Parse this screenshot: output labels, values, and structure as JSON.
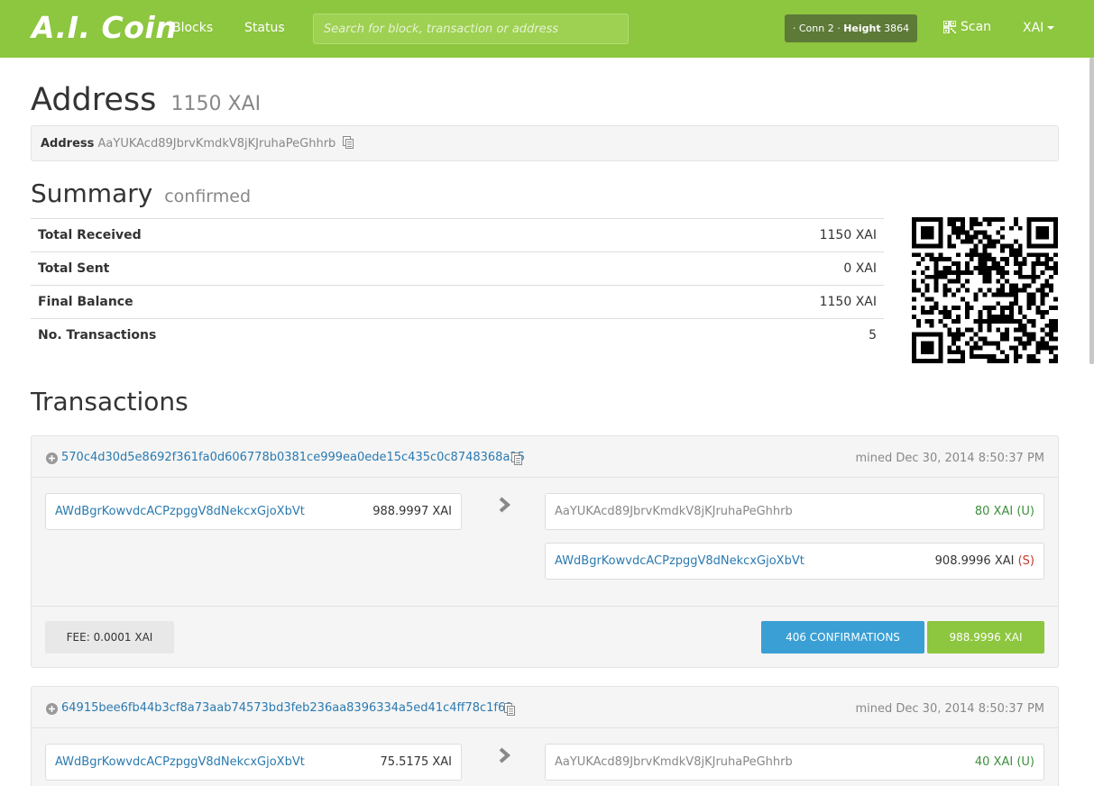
{
  "nav": {
    "brand": "A.I. Coin",
    "links": [
      "Blocks",
      "Status"
    ],
    "search_placeholder": "Search for block, transaction or address",
    "conn_prefix": "· Conn",
    "conn_value": "2",
    "height_label": "Height",
    "height_value": "3864",
    "scan_label": "Scan",
    "currency": "XAI"
  },
  "page": {
    "title": "Address",
    "title_sub": "1150 XAI",
    "address_label": "Address",
    "address_value": "AaYUKAcd89JbrvKmdkV8jKJruhaPeGhhrb"
  },
  "summary": {
    "title": "Summary",
    "title_sub": "confirmed",
    "rows": [
      {
        "label": "Total Received",
        "value": "1150 XAI"
      },
      {
        "label": "Total Sent",
        "value": "0 XAI"
      },
      {
        "label": "Final Balance",
        "value": "1150 XAI"
      },
      {
        "label": "No. Transactions",
        "value": "5"
      }
    ]
  },
  "transactions_title": "Transactions",
  "transactions": [
    {
      "hash": "570c4d30d5e8692f361fa0d606778b0381ce999ea0ede15c435c0c8748368a25",
      "time": "mined Dec 30, 2014 8:50:37 PM",
      "input": {
        "address": "AWdBgrKowvdcACPzpggV8dNekcxGjoXbVt",
        "amount": "988.9997 XAI"
      },
      "outputs": [
        {
          "address": "AaYUKAcd89JbrvKmdkV8jKJruhaPeGhhrb",
          "amount": "80 XAI",
          "flag": "(U)"
        },
        {
          "address": "AWdBgrKowvdcACPzpggV8dNekcxGjoXbVt",
          "amount": "908.9996 XAI",
          "flag": "(S)"
        }
      ],
      "fee": "FEE: 0.0001 XAI",
      "confirmations": "406 CONFIRMATIONS",
      "total": "988.9996 XAI"
    },
    {
      "hash": "64915bee6fb44b3cf8a73aab74573bd3feb236aa8396334a5ed41c4ff78c1f69",
      "time": "mined Dec 30, 2014 8:50:37 PM",
      "input": {
        "address": "AWdBgrKowvdcACPzpggV8dNekcxGjoXbVt",
        "amount": "75.5175 XAI"
      },
      "outputs": [
        {
          "address": "AaYUKAcd89JbrvKmdkV8jKJruhaPeGhhrb",
          "amount": "40 XAI",
          "flag": "(U)"
        }
      ]
    }
  ],
  "colors": {
    "brand": "#8dc63f",
    "link": "#2a7ab0",
    "confirm": "#3a9fd5"
  }
}
